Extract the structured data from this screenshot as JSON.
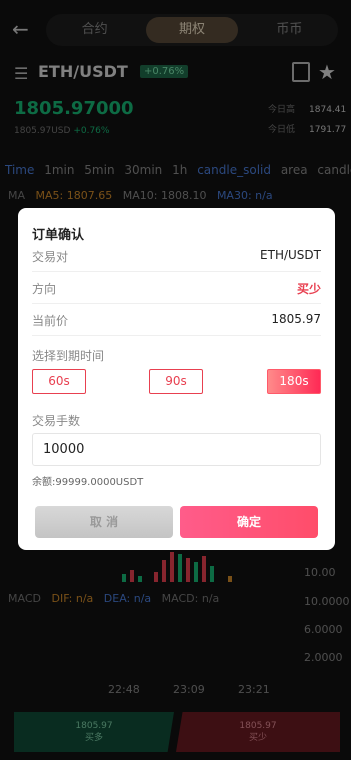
{
  "nav": {
    "tabs": [
      "合约",
      "期权",
      "币币"
    ],
    "active": 1
  },
  "header": {
    "pair": "ETH/USDT",
    "change_badge": "+0.76%"
  },
  "price": {
    "main": "1805.97000",
    "sub": "1805.97USD",
    "sub_change": "+0.76%",
    "high_label": "今日高",
    "high": "1874.41",
    "low_label": "今日低",
    "low": "1791.77"
  },
  "timeframes": [
    "Time",
    "1min",
    "5min",
    "30min",
    "1h",
    "candle_solid",
    "area",
    "candle_st"
  ],
  "ma": {
    "label": "MA",
    "ma5": "MA5: 1807.65",
    "ma10": "MA10: 1808.10",
    "ma30": "MA30: n/a"
  },
  "axis_right": [
    "10.00",
    "10.0000",
    "6.0000",
    "2.0000"
  ],
  "macd": {
    "label": "MACD",
    "dif": "DIF: n/a",
    "dea": "DEA: n/a",
    "macd": "MACD: n/a"
  },
  "times": [
    "22:48",
    "23:09",
    "23:21"
  ],
  "bottom": {
    "long_price": "1805.97",
    "long_label": "买多",
    "short_price": "1805.97",
    "short_label": "买少"
  },
  "colors": {
    "up": "#17b876",
    "down": "#e84050",
    "accent_gold": "#f0e2c8"
  },
  "modal": {
    "title": "订单确认",
    "rows": [
      {
        "key": "交易对",
        "value": "ETH/USDT"
      },
      {
        "key": "方向",
        "value": "买少"
      },
      {
        "key": "当前价",
        "value": "1805.97"
      }
    ],
    "expiry_label": "选择到期时间",
    "expiry_options": [
      "60s",
      "90s",
      "180s"
    ],
    "expiry_selected": "180s",
    "amount_label": "交易手数",
    "amount_value": "10000",
    "balance": "余额:99999.0000USDT",
    "cancel": "取 消",
    "confirm": "确定"
  }
}
